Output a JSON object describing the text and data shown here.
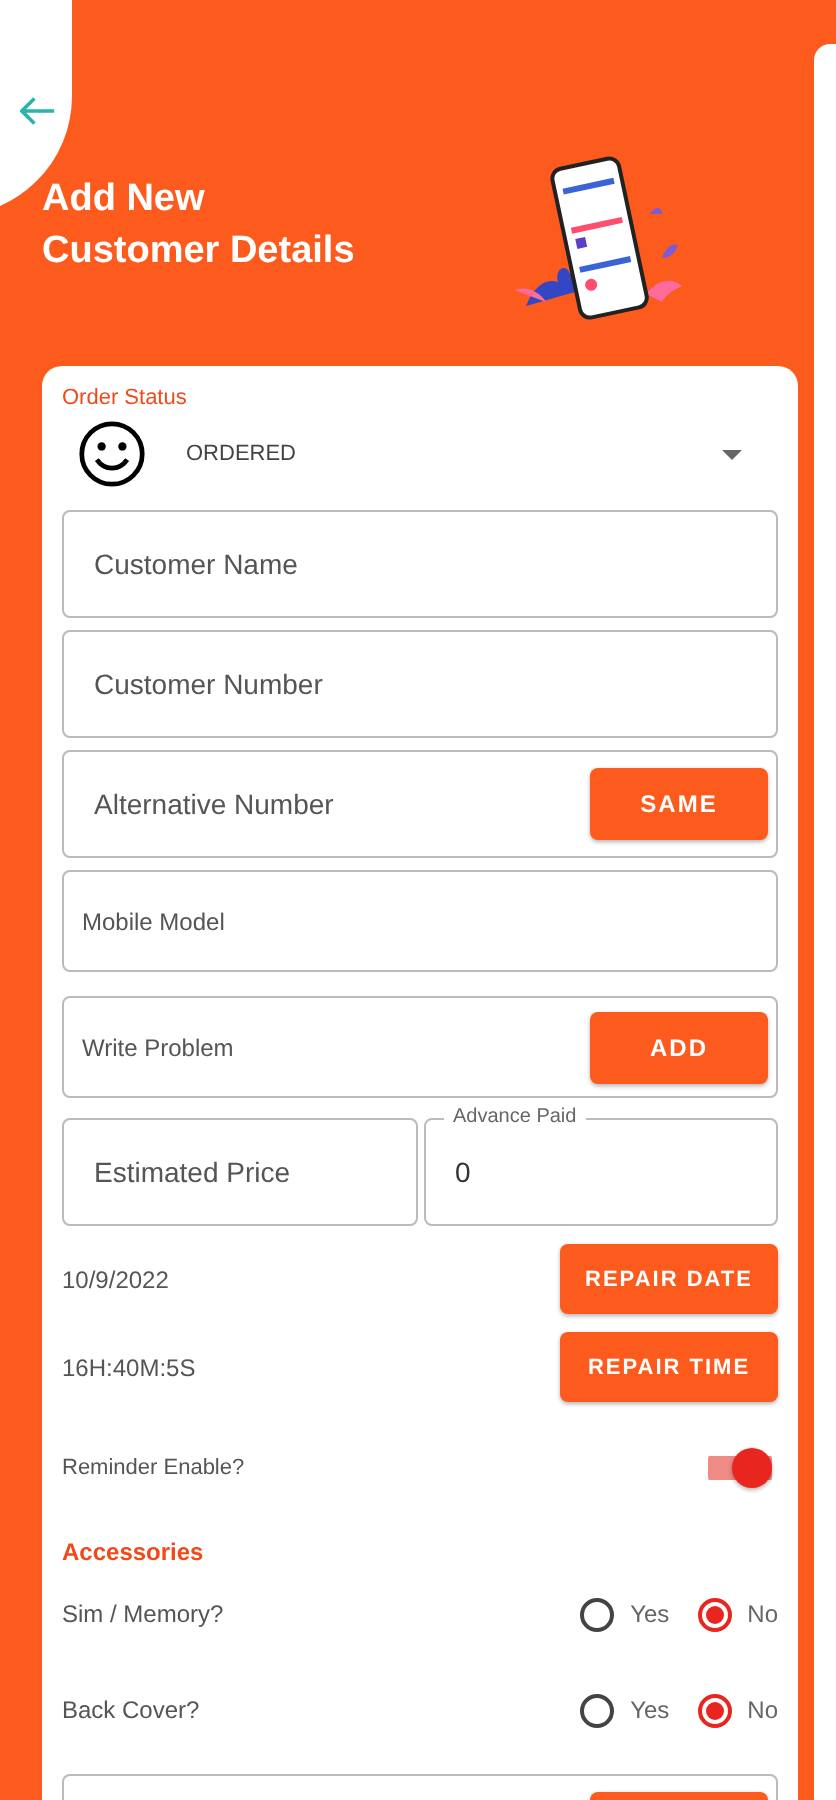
{
  "header": {
    "title": "Add New\nCustomer Details"
  },
  "order_status": {
    "label": "Order Status",
    "value": "ORDERED"
  },
  "fields": [
    {
      "kind": "text",
      "placeholder": "Customer Name"
    },
    {
      "kind": "text",
      "placeholder": "Customer Number"
    },
    {
      "kind": "with_button",
      "placeholder": "Alternative Number",
      "button": "SAME"
    },
    {
      "kind": "text_small",
      "placeholder": "Mobile Model"
    },
    {
      "kind": "with_button_small",
      "placeholder": "Write Problem",
      "button": "ADD"
    },
    {
      "kind": "pair",
      "left": {
        "placeholder": "Estimated Price"
      },
      "right": {
        "label": "Advance Paid",
        "value": "0"
      }
    }
  ],
  "schedule": [
    {
      "value": "10/9/2022",
      "button": "REPAIR DATE"
    },
    {
      "value": "16H:40M:5S",
      "button": "REPAIR TIME"
    }
  ],
  "reminder": {
    "label": "Reminder Enable?",
    "on": true
  },
  "accessories": {
    "title": "Accessories",
    "items": [
      {
        "label": "Sim / Memory?",
        "options": [
          {
            "label": "Yes",
            "selected": false
          },
          {
            "label": "No",
            "selected": true
          }
        ]
      },
      {
        "label": "Back Cover?",
        "options": [
          {
            "label": "Yes",
            "selected": false
          },
          {
            "label": "No",
            "selected": true
          }
        ]
      }
    ]
  },
  "more_field": {
    "kind": "with_button"
  }
}
